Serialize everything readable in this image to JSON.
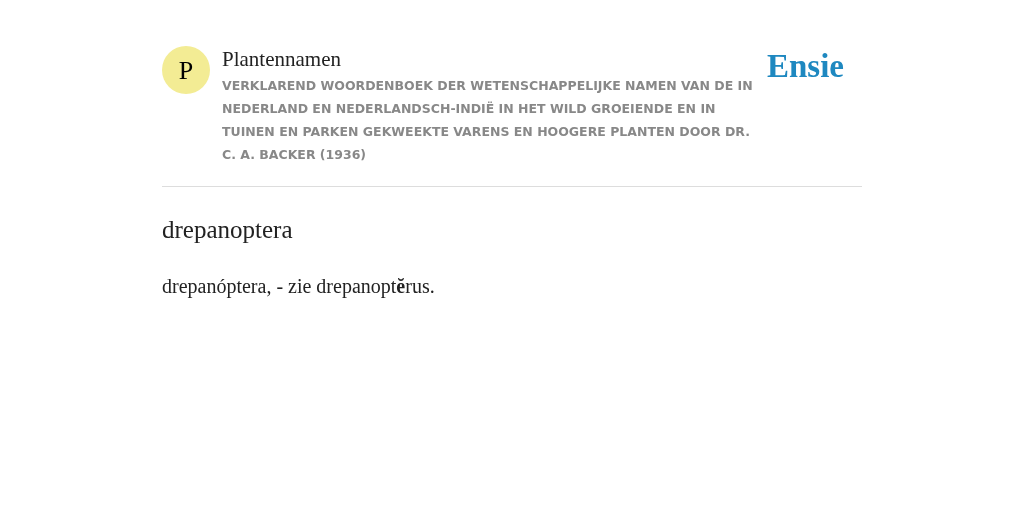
{
  "header": {
    "logo_letter": "P",
    "title": "Plantennamen",
    "subtitle": "VERKLAREND WOORDENBOEK DER WETENSCHAPPELIJKE NAMEN VAN DE IN NEDERLAND EN NEDERLANDSCH-INDIË IN HET WILD GROEIENDE EN IN TUINEN EN PARKEN GEKWEEKTE VARENS EN HOOGERE PLANTEN DOOR DR. C. A. BACKER (1936)",
    "brand": "Ensie"
  },
  "entry": {
    "term": "drepanoptera",
    "definition": "drepanóptera, - zie drepanopt**ĕ**rus."
  }
}
